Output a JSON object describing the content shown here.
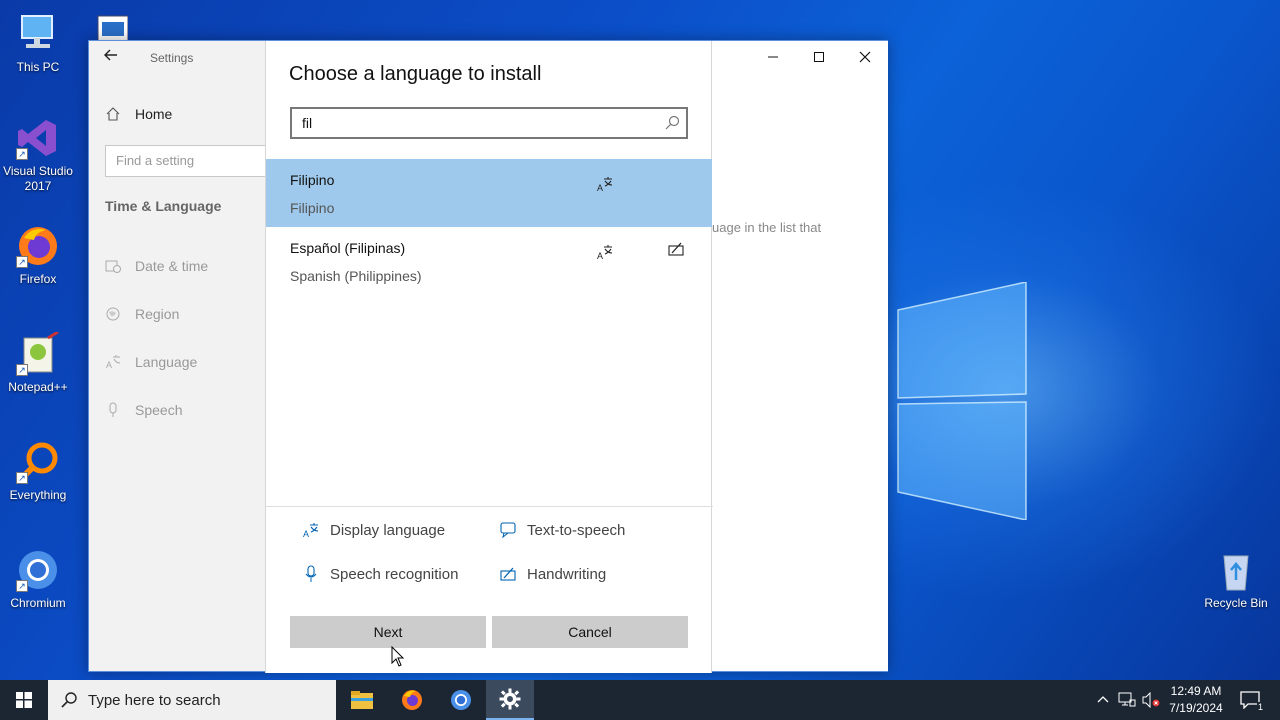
{
  "desktop": {
    "icons": [
      {
        "label": "This PC",
        "icon": "this-pc-icon"
      },
      {
        "label": "Visual Studio 2017",
        "icon": "visual-studio-icon"
      },
      {
        "label": "Firefox",
        "icon": "firefox-icon"
      },
      {
        "label": "Notepad++",
        "icon": "notepadpp-icon"
      },
      {
        "label": "Everything",
        "icon": "everything-icon"
      },
      {
        "label": "Chromium",
        "icon": "chromium-icon"
      },
      {
        "label": "Recycle Bin",
        "icon": "recycle-bin-icon"
      }
    ]
  },
  "settings": {
    "app_title": "Settings",
    "home_label": "Home",
    "find_placeholder": "Find a setting",
    "section_heading": "Time & Language",
    "nav": [
      {
        "label": "Date & time",
        "icon": "calendar-clock-icon"
      },
      {
        "label": "Region",
        "icon": "globe-icon"
      },
      {
        "label": "Language",
        "icon": "language-icon"
      },
      {
        "label": "Speech",
        "icon": "microphone-icon"
      }
    ],
    "background_text": "uage in the list that"
  },
  "dialog": {
    "title": "Choose a language to install",
    "search_value": "fil",
    "results": [
      {
        "name": "Filipino",
        "sub": "Filipino",
        "selected": true,
        "features": [
          "display-language"
        ]
      },
      {
        "name": "Español (Filipinas)",
        "sub": "Spanish (Philippines)",
        "selected": false,
        "features": [
          "display-language",
          "handwriting"
        ]
      }
    ],
    "legend": {
      "display_language": "Display language",
      "text_to_speech": "Text-to-speech",
      "speech_recognition": "Speech recognition",
      "handwriting": "Handwriting"
    },
    "next_label": "Next",
    "cancel_label": "Cancel"
  },
  "taskbar": {
    "search_placeholder": "Type here to search",
    "time": "12:49 AM",
    "date": "7/19/2024",
    "notification_count": "1"
  },
  "colors": {
    "selected_row": "#9fc9ec",
    "accent": "#0063b1",
    "taskbar": "#1c2633"
  }
}
